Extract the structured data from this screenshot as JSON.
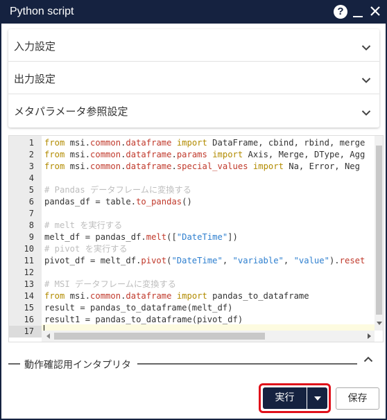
{
  "window": {
    "title": "Python script",
    "help_label": "?"
  },
  "settings": {
    "sections": [
      {
        "label": "入力設定"
      },
      {
        "label": "出力設定"
      },
      {
        "label": "メタパラメータ参照設定"
      }
    ]
  },
  "editor": {
    "line_numbers": [
      "1",
      "2",
      "3",
      "4",
      "5",
      "6",
      "7",
      "8",
      "9",
      "10",
      "11",
      "12",
      "13",
      "14",
      "15",
      "16",
      "17"
    ],
    "active_line": 17,
    "lines": [
      [
        {
          "t": "from",
          "c": "kw"
        },
        {
          "t": " msi."
        },
        {
          "t": "common",
          "c": "fn"
        },
        {
          "t": "."
        },
        {
          "t": "dataframe",
          "c": "fn"
        },
        {
          "t": " "
        },
        {
          "t": "import",
          "c": "kw"
        },
        {
          "t": " DataFrame, cbind, rbind, merge"
        }
      ],
      [
        {
          "t": "from",
          "c": "kw"
        },
        {
          "t": " msi."
        },
        {
          "t": "common",
          "c": "fn"
        },
        {
          "t": "."
        },
        {
          "t": "dataframe",
          "c": "fn"
        },
        {
          "t": "."
        },
        {
          "t": "params",
          "c": "fn"
        },
        {
          "t": " "
        },
        {
          "t": "import",
          "c": "kw"
        },
        {
          "t": " Axis, Merge, DType, Agg"
        }
      ],
      [
        {
          "t": "from",
          "c": "kw"
        },
        {
          "t": " msi."
        },
        {
          "t": "common",
          "c": "fn"
        },
        {
          "t": "."
        },
        {
          "t": "dataframe",
          "c": "fn"
        },
        {
          "t": "."
        },
        {
          "t": "special_values",
          "c": "fn"
        },
        {
          "t": " "
        },
        {
          "t": "import",
          "c": "kw"
        },
        {
          "t": " Na, Error, Neg"
        }
      ],
      [],
      [
        {
          "t": "# Pandas データフレームに変換する",
          "c": "cm"
        }
      ],
      [
        {
          "t": "pandas_df = table."
        },
        {
          "t": "to_pandas",
          "c": "fn"
        },
        {
          "t": "()"
        }
      ],
      [],
      [
        {
          "t": "# melt を実行する",
          "c": "cm"
        }
      ],
      [
        {
          "t": "melt_df = pandas_df."
        },
        {
          "t": "melt",
          "c": "fn"
        },
        {
          "t": "(["
        },
        {
          "t": "\"DateTime\"",
          "c": "str"
        },
        {
          "t": "])"
        }
      ],
      [
        {
          "t": "# pivot を実行する",
          "c": "cm"
        }
      ],
      [
        {
          "t": "pivot_df = melt_df."
        },
        {
          "t": "pivot",
          "c": "fn"
        },
        {
          "t": "("
        },
        {
          "t": "\"DateTime\"",
          "c": "str"
        },
        {
          "t": ", "
        },
        {
          "t": "\"variable\"",
          "c": "str"
        },
        {
          "t": ", "
        },
        {
          "t": "\"value\"",
          "c": "str"
        },
        {
          "t": ")."
        },
        {
          "t": "reset",
          "c": "fn"
        }
      ],
      [],
      [
        {
          "t": "# MSI データフレームに変換する",
          "c": "cm"
        }
      ],
      [
        {
          "t": "from",
          "c": "kw"
        },
        {
          "t": " msi."
        },
        {
          "t": "common",
          "c": "fn"
        },
        {
          "t": "."
        },
        {
          "t": "dataframe",
          "c": "fn"
        },
        {
          "t": " "
        },
        {
          "t": "import",
          "c": "kw"
        },
        {
          "t": " pandas_to_dataframe"
        }
      ],
      [
        {
          "t": "result = pandas_to_dataframe(melt_df)"
        }
      ],
      [
        {
          "t": "result1 = pandas_to_dataframe(pivot_df)"
        }
      ],
      []
    ]
  },
  "interpreter": {
    "label": "動作確認用インタプリタ"
  },
  "footer": {
    "run_label": "実行",
    "save_label": "保存"
  },
  "colors": {
    "titlebar": "#152240",
    "keyword": "#b28b00",
    "function": "#c0392b",
    "string": "#2e7fcf",
    "comment": "#bdbdbd",
    "highlight_border": "#e0101a"
  },
  "icons": [
    "help-icon",
    "minimize-icon",
    "close-icon",
    "chevron-down-icon",
    "chevron-up-icon",
    "caret-down-icon"
  ]
}
